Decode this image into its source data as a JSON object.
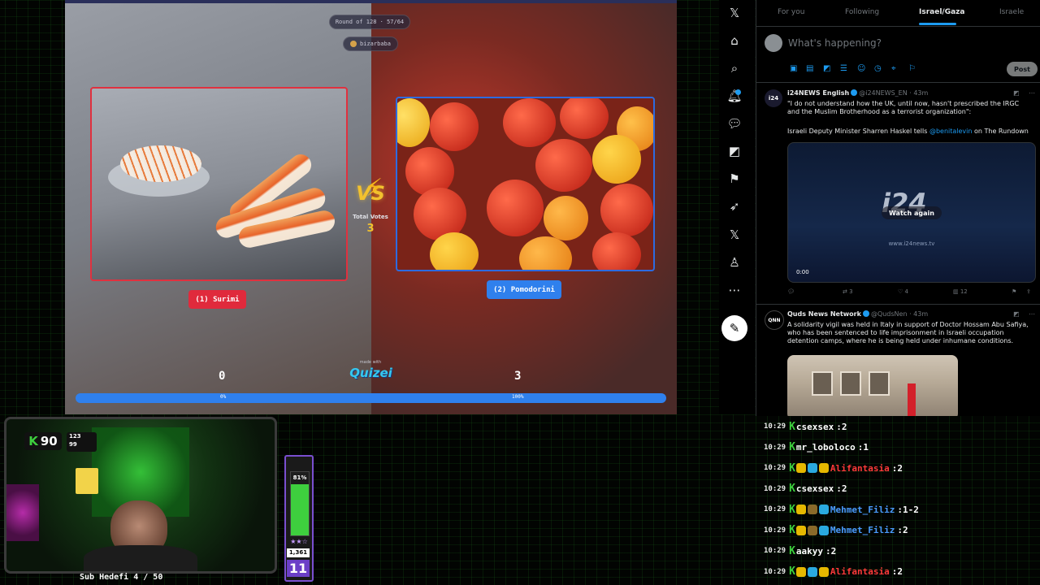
{
  "game": {
    "round_text": "Round of 128 · 57/64",
    "user": "bizarbaba",
    "left_option": "(1) Surimi",
    "right_option": "(2) Pomodorini",
    "vs_label": "VS",
    "total_votes_label": "Total Votes",
    "total_votes": "3",
    "score_left": "0",
    "score_right": "3",
    "made_with": "made with",
    "brand": "Quizei",
    "progress_left_label": "0%",
    "progress_right_label": "100%",
    "progress_left_fraction": 0.0,
    "colors": {
      "left": "#e02a3c",
      "right": "#2f80ed",
      "vs": "#f2c12e"
    }
  },
  "twitter": {
    "nav_icons": [
      "x-logo-icon",
      "home-icon",
      "search-icon",
      "notifications-icon",
      "messages-icon",
      "grok-icon",
      "bookmarks-icon",
      "jobs-icon",
      "premium-x-icon",
      "profile-icon",
      "more-icon",
      "compose-icon"
    ],
    "tabs": [
      {
        "label": "For you"
      },
      {
        "label": "Following"
      },
      {
        "label": "Israel/Gaza"
      },
      {
        "label": "Israele"
      }
    ],
    "compose_placeholder": "What's happening?",
    "post_label": "Post",
    "tweets": [
      {
        "name": "i24NEWS English",
        "handle": "@i24NEWS_EN · 43m",
        "avatar_text": "i24",
        "text1": "\"I do not understand how the UK, until now, hasn't prescribed the IRGC and the Muslim Brotherhood as a terrorist organization\":",
        "text2_pre": "Israeli Deputy Minister Sharren Haskel tells ",
        "text2_link": "@benitalevin",
        "text2_post": " on The Rundown",
        "video_logo": "i24",
        "video_sub": "NEWS",
        "video_watch": "Watch again",
        "video_site": "www.i24news.tv",
        "video_time": "0:00",
        "retweets": "3",
        "likes": "4",
        "views": "12"
      },
      {
        "name": "Quds News Network",
        "handle": "@QudsNen · 43m",
        "avatar_text": "QNN",
        "text1": "A solidarity vigil was held in Italy in support of Doctor Hossam Abu Safiya, who has been sentenced to life imprisonment in Israeli occupation detention camps, where he is being held under inhumane conditions."
      }
    ]
  },
  "chat": {
    "messages": [
      {
        "time": "10:29",
        "user": "csexsex",
        "text": "2",
        "color": "#ffffff"
      },
      {
        "time": "10:29",
        "user": "mr_loboloco",
        "text": "1",
        "color": "#ffffff"
      },
      {
        "time": "10:29",
        "user": "Alifantasia",
        "text": "2",
        "color": "#ff3a3a"
      },
      {
        "time": "10:29",
        "user": "csexsex",
        "text": "2",
        "color": "#ffffff"
      },
      {
        "time": "10:29",
        "user": "Mehmet_Filiz",
        "text": "1-2",
        "color": "#4a9cff"
      },
      {
        "time": "10:29",
        "user": "Mehmet_Filiz",
        "text": "2",
        "color": "#4a9cff"
      },
      {
        "time": "10:29",
        "user": "aakyy",
        "text": "2",
        "color": "#ffffff"
      },
      {
        "time": "10:29",
        "user": "Alifantasia",
        "text": "2",
        "color": "#ff3a3a"
      }
    ]
  },
  "stream": {
    "kick_score": "90",
    "stat_top": "123",
    "stat_bottom": "99",
    "sub_goal": "Sub Hedefi 4 / 50",
    "meter_percent": "81%",
    "meter_fraction": 0.81,
    "meter_stars": "★★☆",
    "meter_count": "1,361",
    "meter_level": "11"
  }
}
